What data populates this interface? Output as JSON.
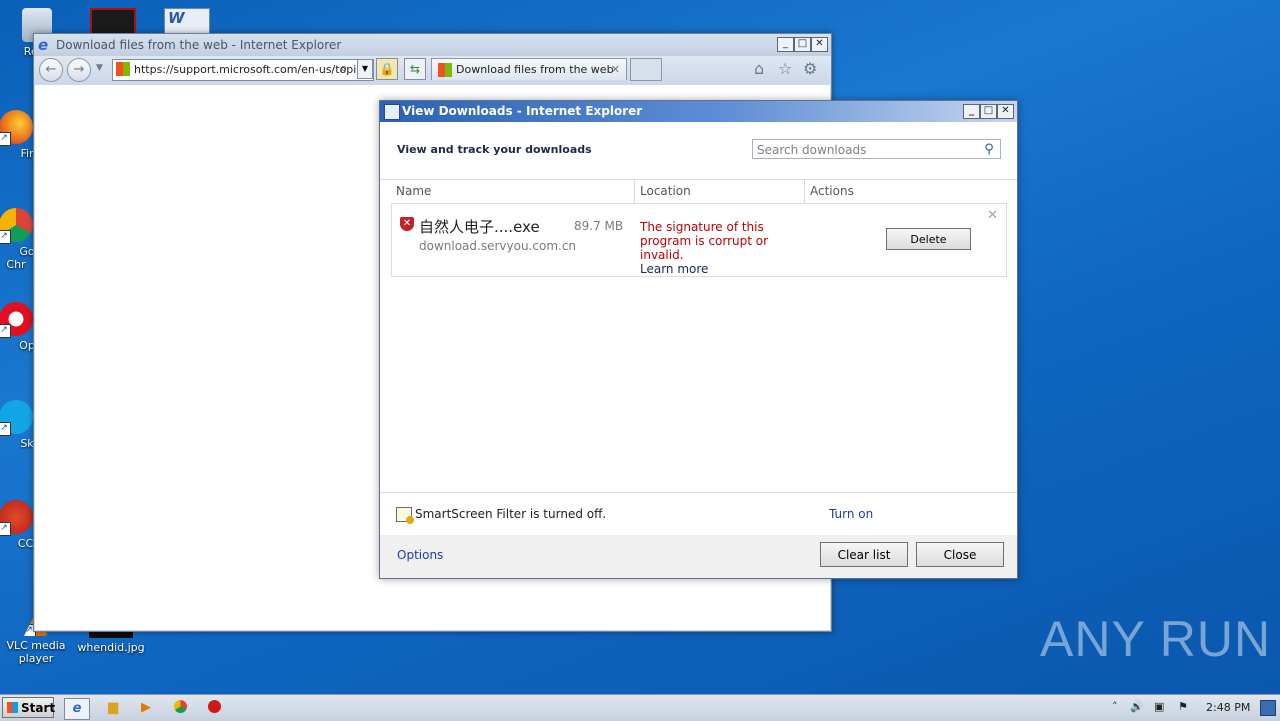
{
  "desktop": {
    "icons": [
      {
        "label": "Recy",
        "name": "recycle-bin-icon"
      },
      {
        "label": "Fir",
        "name": "firefox-icon"
      },
      {
        "label": "Go\nChr",
        "name": "chrome-icon"
      },
      {
        "label": "Op",
        "name": "opera-icon"
      },
      {
        "label": "Sk",
        "name": "skype-icon"
      },
      {
        "label": "CCl",
        "name": "ccleaner-icon"
      },
      {
        "label": "VLC media\nplayer",
        "name": "vlc-icon"
      },
      {
        "label": "whendid.jpg",
        "name": "image-file-icon"
      }
    ],
    "watermark": "ANY RUN"
  },
  "ie": {
    "title": "Download files from the web - Internet Explorer",
    "address": "https://support.microsoft.com/en-us/topic",
    "tab_label": "Download files from the web"
  },
  "downloads": {
    "title": "View Downloads - Internet Explorer",
    "heading": "View and track your downloads",
    "search_placeholder": "Search downloads",
    "columns": [
      "Name",
      "Location",
      "Actions"
    ],
    "item": {
      "filename": "自然人电子....exe",
      "size": "89.7 MB",
      "source": "download.servyou.com.cn",
      "warning": "The signature of this program is corrupt or invalid.",
      "learn_more": "Learn more",
      "delete_label": "Delete"
    },
    "smartscreen_text": "SmartScreen Filter is turned off.",
    "turn_on": "Turn on",
    "options": "Options",
    "clear_list": "Clear list",
    "close": "Close"
  },
  "taskbar": {
    "start": "Start",
    "clock": "2:48 PM"
  }
}
